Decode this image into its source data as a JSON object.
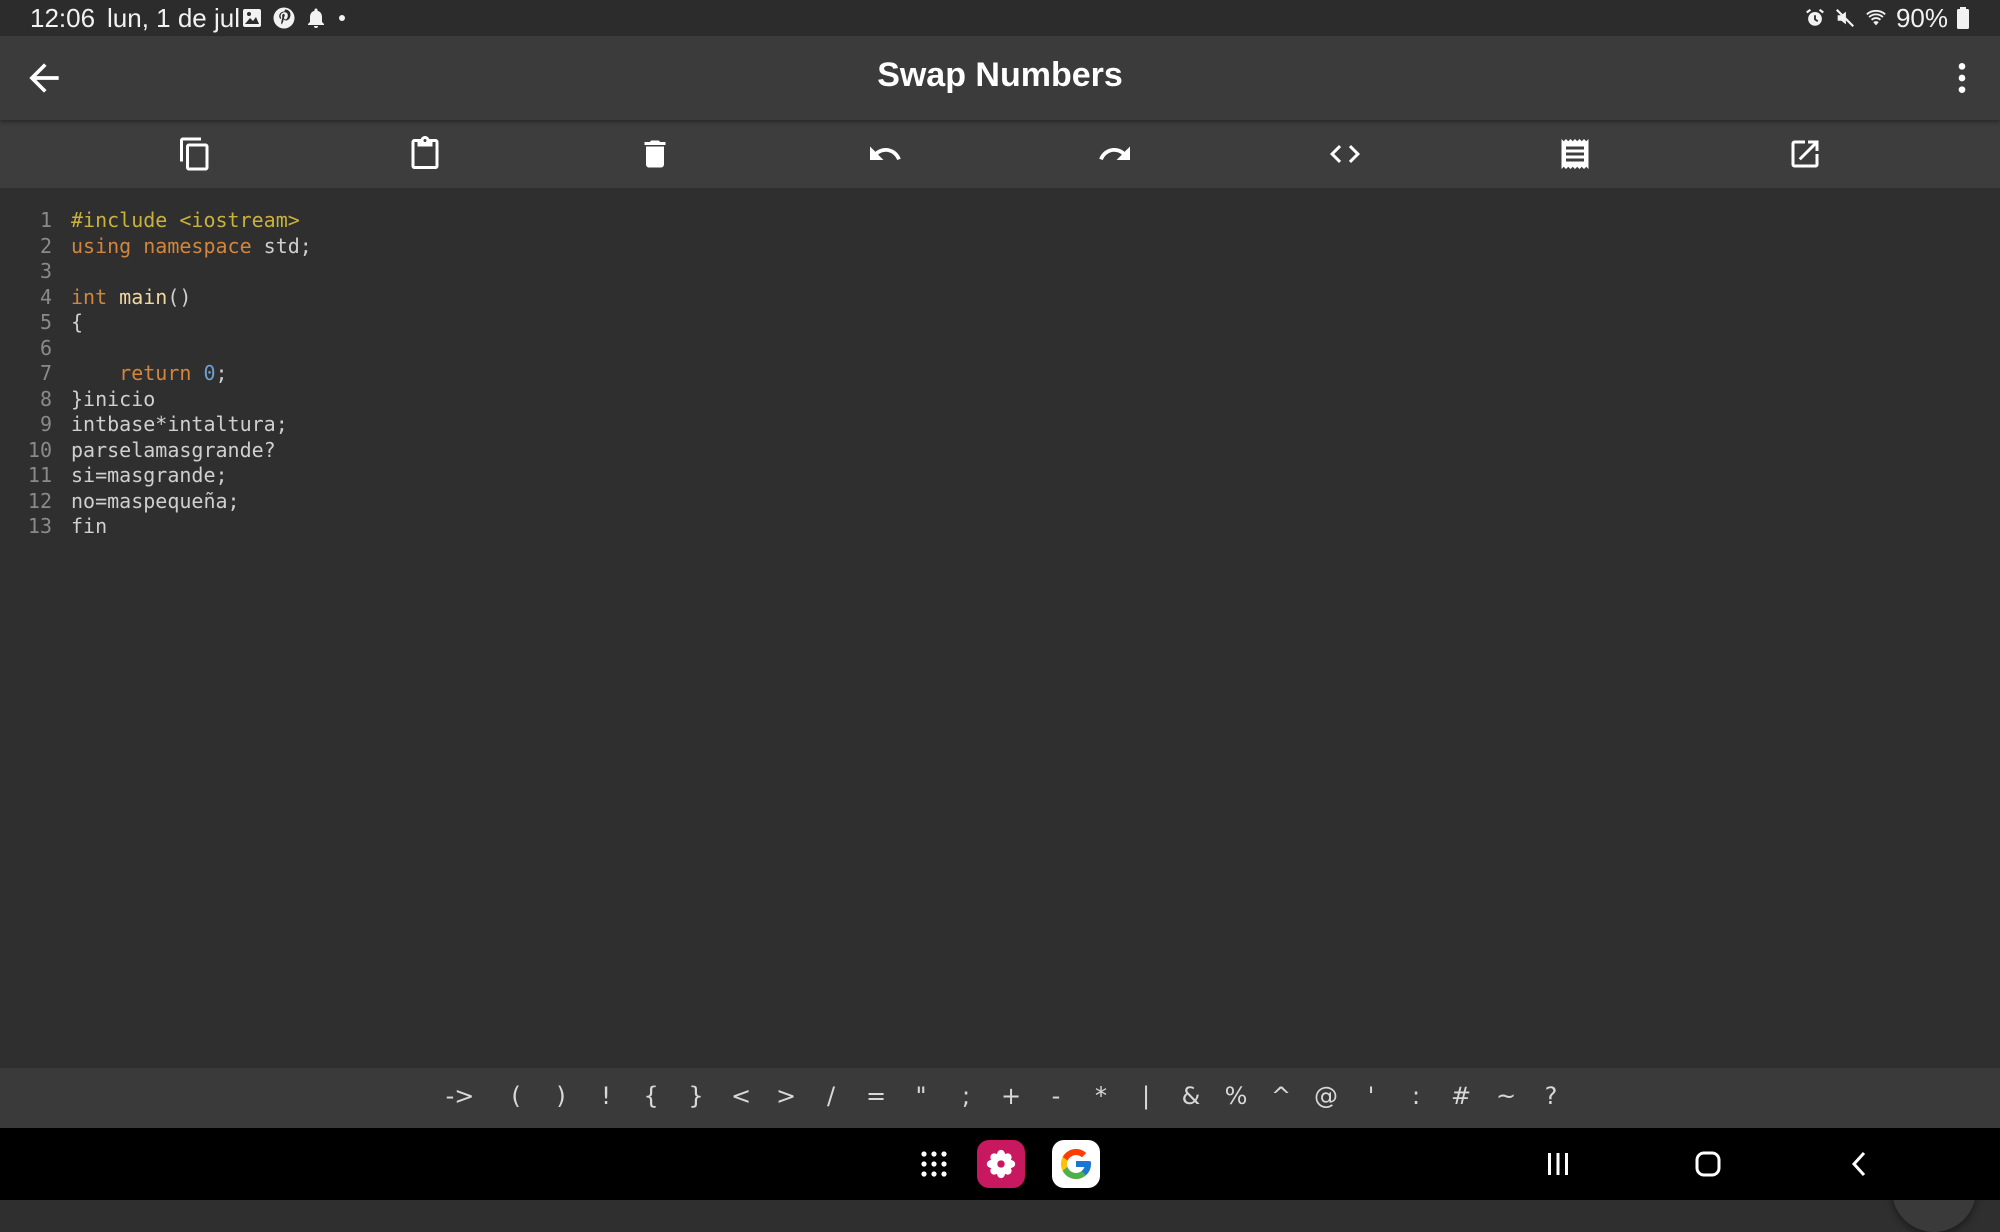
{
  "status_bar": {
    "time": "12:06",
    "date": "lun, 1 de jul",
    "battery": "90%",
    "left_icons": [
      "gallery-icon",
      "pinterest-icon",
      "bell-icon",
      "dot-icon"
    ],
    "right_icons": [
      "alarm-icon",
      "mute-icon",
      "wifi-icon",
      "battery-icon"
    ]
  },
  "app_bar": {
    "title": "Swap Numbers"
  },
  "toolbar": {
    "buttons": [
      "copy-icon",
      "paste-icon",
      "delete-icon",
      "undo-icon",
      "redo-icon",
      "code-icon",
      "notes-icon",
      "open-external-icon"
    ]
  },
  "editor": {
    "lines": [
      {
        "n": "1",
        "t": [
          "#include <iostream>"
        ]
      },
      {
        "n": "2",
        "t": [
          "using namespace",
          " std;"
        ]
      },
      {
        "n": "3",
        "t": [
          ""
        ]
      },
      {
        "n": "4",
        "t": [
          "int",
          " ",
          "main",
          "()"
        ]
      },
      {
        "n": "5",
        "t": [
          "{"
        ]
      },
      {
        "n": "6",
        "t": [
          ""
        ]
      },
      {
        "n": "7",
        "t": [
          "    ",
          "return",
          " ",
          "0",
          ";"
        ]
      },
      {
        "n": "8",
        "t": [
          "}inicio"
        ]
      },
      {
        "n": "9",
        "t": [
          "intbase*intaltura;"
        ]
      },
      {
        "n": "10",
        "t": [
          "parselamasgrande?"
        ]
      },
      {
        "n": "11",
        "t": [
          "si=masgrande;"
        ]
      },
      {
        "n": "12",
        "t": [
          "no=maspequeña;"
        ]
      },
      {
        "n": "13",
        "t": [
          "fin"
        ]
      }
    ]
  },
  "symbols": [
    "->",
    "(",
    ")",
    "!",
    "{",
    "}",
    "<",
    ">",
    "/",
    "=",
    "\"",
    ";",
    "+",
    "-",
    "*",
    "|",
    "&",
    "%",
    "^",
    "@",
    "'",
    ":",
    "#",
    "~",
    "?"
  ],
  "colors": {
    "background": "#2f2f2f",
    "keyword": "#d3863b",
    "preprocessor": "#c8b23a",
    "function": "#f0d9a0",
    "number": "#6e9fcf"
  }
}
